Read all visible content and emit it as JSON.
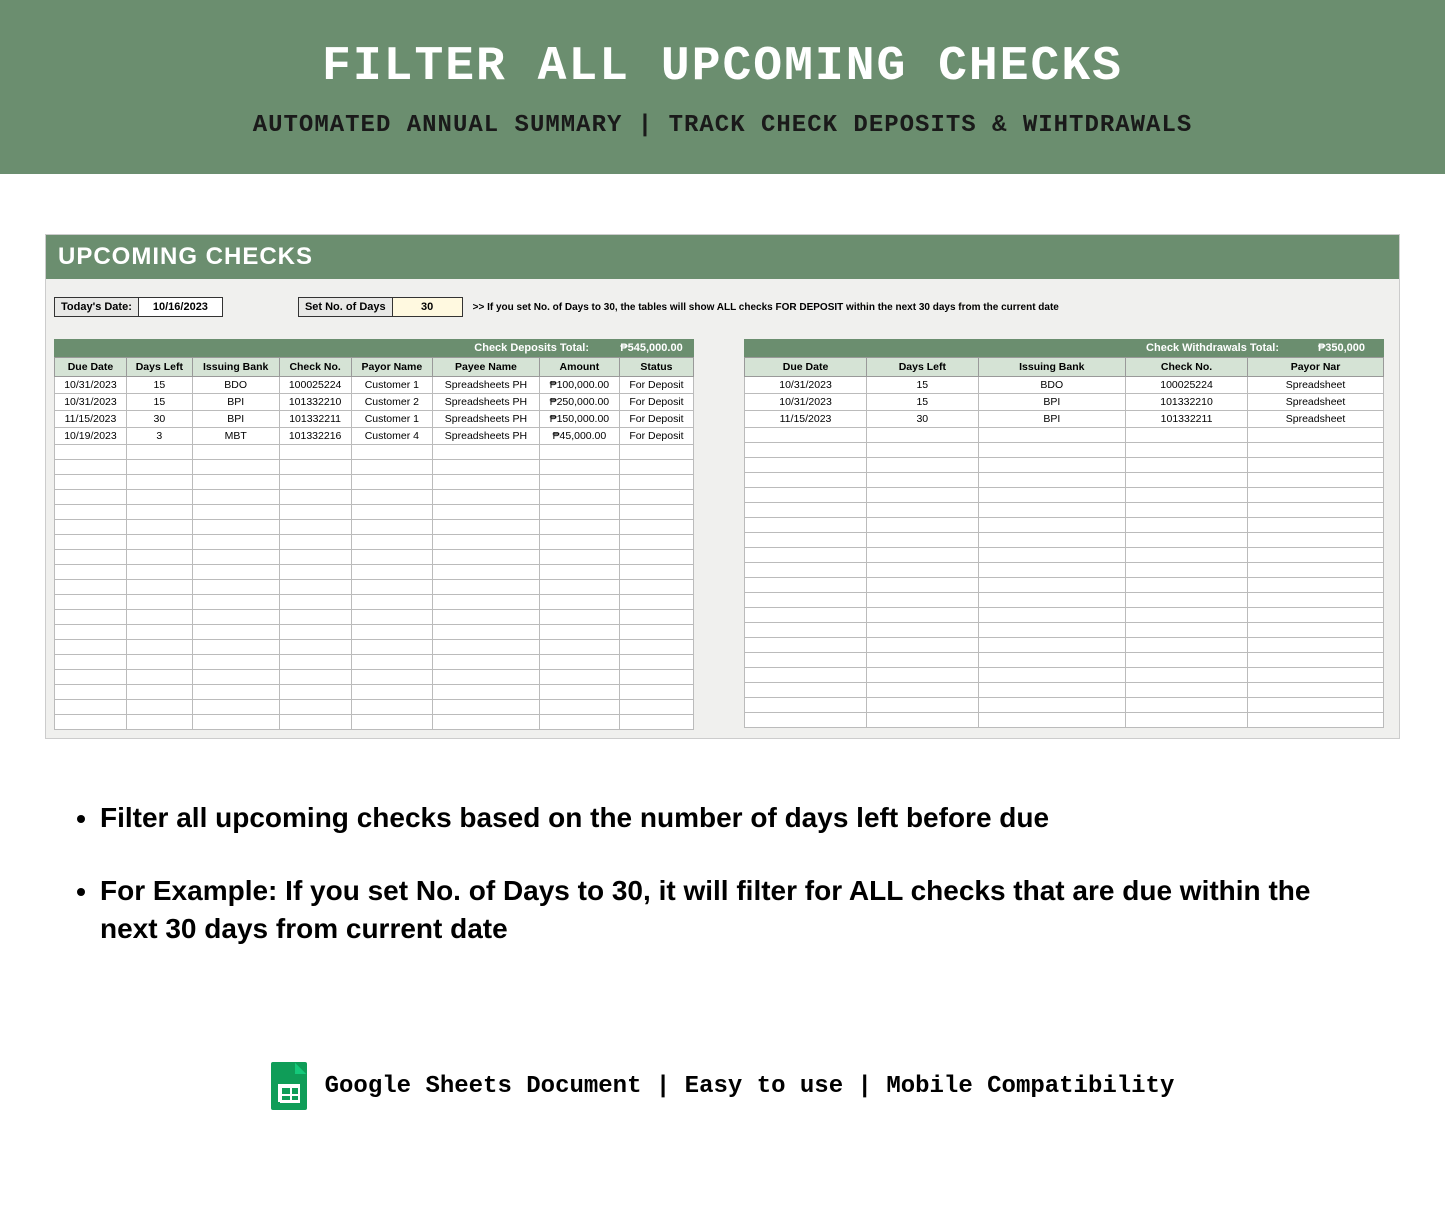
{
  "header": {
    "title": "FILTER ALL UPCOMING CHECKS",
    "subtitle": "AUTOMATED ANNUAL SUMMARY | TRACK CHECK DEPOSITS & WIHTDRAWALS"
  },
  "sheet": {
    "panel_title": "UPCOMING CHECKS",
    "today_label": "Today's Date:",
    "today_value": "10/16/2023",
    "days_label": "Set No. of Days",
    "days_value": "30",
    "days_note": ">> If you set No. of Days to 30, the tables will show ALL checks FOR DEPOSIT within the next 30 days from the current date"
  },
  "deposits": {
    "total_label": "Check Deposits Total:",
    "total_value": "₱545,000.00",
    "headers": [
      "Due Date",
      "Days Left",
      "Issuing Bank",
      "Check No.",
      "Payor Name",
      "Payee Name",
      "Amount",
      "Status"
    ],
    "rows": [
      [
        "10/31/2023",
        "15",
        "BDO",
        "100025224",
        "Customer 1",
        "Spreadsheets PH",
        "₱100,000.00",
        "For Deposit"
      ],
      [
        "10/31/2023",
        "15",
        "BPI",
        "101332210",
        "Customer 2",
        "Spreadsheets PH",
        "₱250,000.00",
        "For Deposit"
      ],
      [
        "11/15/2023",
        "30",
        "BPI",
        "101332211",
        "Customer 1",
        "Spreadsheets PH",
        "₱150,000.00",
        "For Deposit"
      ],
      [
        "10/19/2023",
        "3",
        "MBT",
        "101332216",
        "Customer 4",
        "Spreadsheets PH",
        "₱45,000.00",
        "For Deposit"
      ]
    ],
    "empty_rows": 19
  },
  "withdrawals": {
    "total_label": "Check Withdrawals Total:",
    "total_value": "₱350,000",
    "headers": [
      "Due Date",
      "Days Left",
      "Issuing Bank",
      "Check No.",
      "Payor Nar"
    ],
    "rows": [
      [
        "10/31/2023",
        "15",
        "BDO",
        "100025224",
        "Spreadsheet"
      ],
      [
        "10/31/2023",
        "15",
        "BPI",
        "101332210",
        "Spreadsheet"
      ],
      [
        "11/15/2023",
        "30",
        "BPI",
        "101332211",
        "Spreadsheet"
      ]
    ],
    "empty_rows": 20
  },
  "bullets": [
    "Filter all upcoming checks based on the number of days left before due",
    "For Example: If you set No. of Days to 30, it will filter for ALL checks that are due within the next 30 days from current date"
  ],
  "footer": {
    "text": "Google Sheets Document  | Easy to use | Mobile Compatibility"
  }
}
